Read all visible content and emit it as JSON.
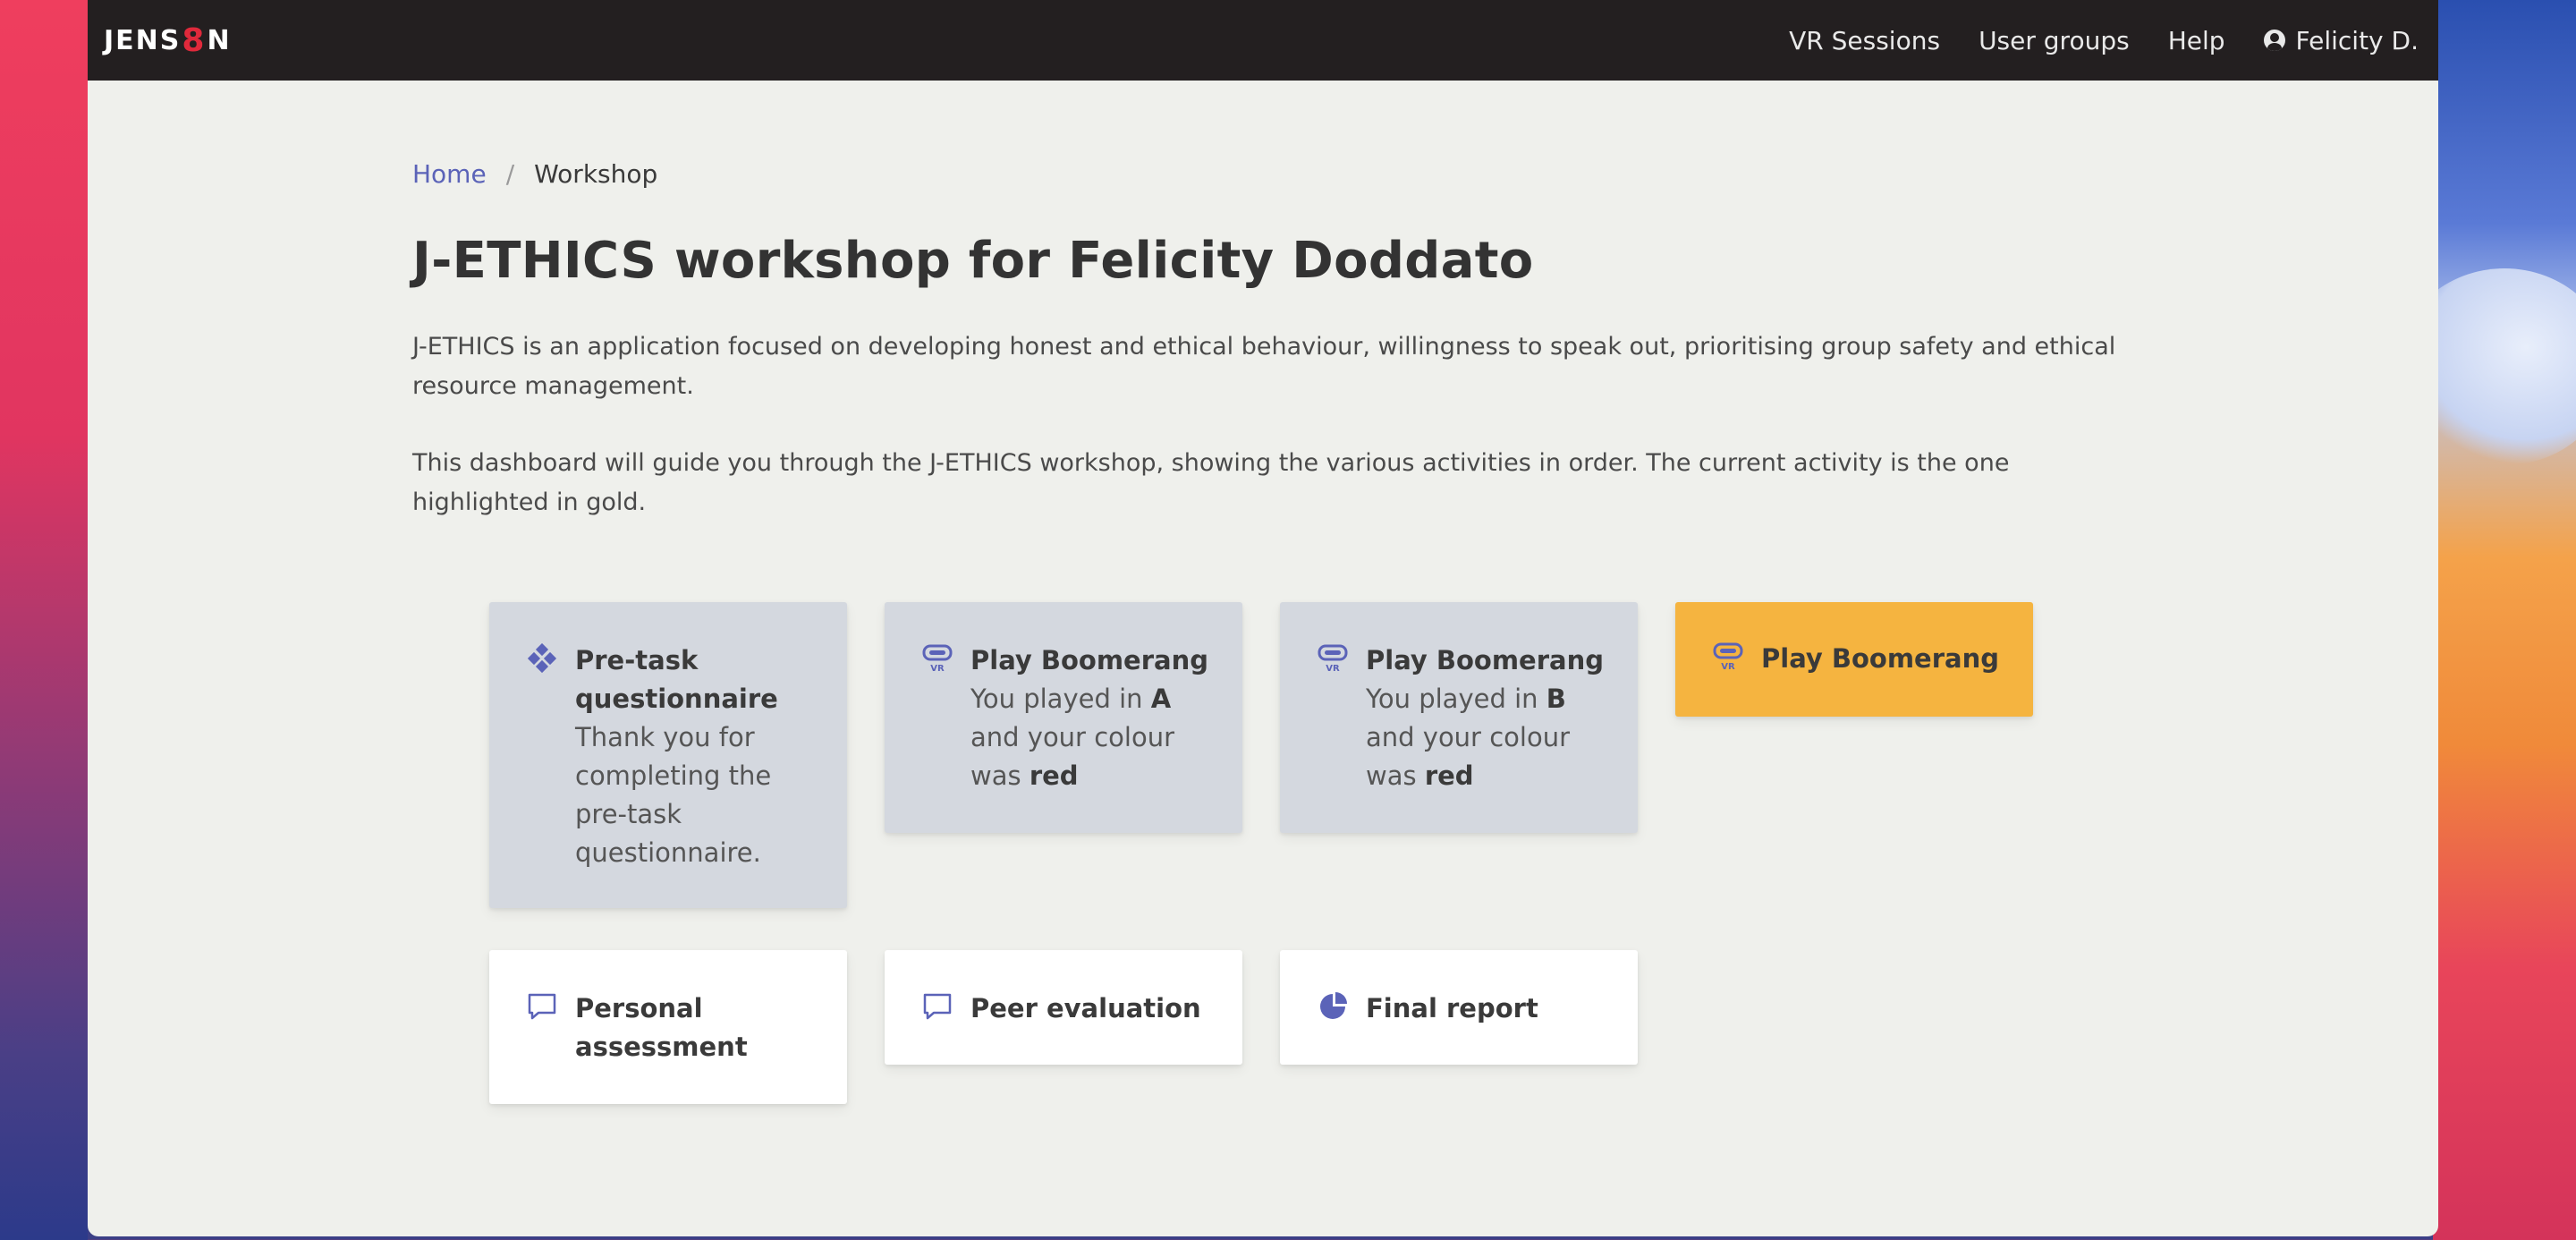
{
  "nav": {
    "brand_prefix": "JENS",
    "brand_mark": "8",
    "brand_suffix": "N",
    "links": [
      "VR Sessions",
      "User groups",
      "Help"
    ],
    "user_name": "Felicity D."
  },
  "breadcrumb": {
    "home": "Home",
    "separator": "/",
    "current": "Workshop"
  },
  "page": {
    "title": "J-ETHICS workshop for Felicity Doddato",
    "para1": "J-ETHICS is an application focused on developing honest and ethical behaviour, willingness to speak out, prioritising group safety and ethical resource management.",
    "para2": "This dashboard will guide you through the J-ETHICS workshop, showing the various activities in order. The current activity is the one highlighted in gold."
  },
  "cards": {
    "c1": {
      "title": "Pre-task questionnaire",
      "desc": "Thank you for completing the pre-task questionnaire.",
      "icon": "diamond-grid-icon"
    },
    "c2": {
      "title": "Play Boomerang",
      "desc_a": "You played in ",
      "group": "A",
      "desc_b": " and your colour was ",
      "colour": "red",
      "icon": "vr-headset-icon"
    },
    "c3": {
      "title": "Play Boomerang",
      "desc_a": "You played in ",
      "group": "B",
      "desc_b": " and your colour was ",
      "colour": "red",
      "icon": "vr-headset-icon"
    },
    "c4": {
      "title": "Play Boomerang",
      "icon": "vr-headset-icon"
    },
    "c5": {
      "title": "Personal assessment",
      "icon": "speech-bubble-icon"
    },
    "c6": {
      "title": "Peer evaluation",
      "icon": "speech-bubble-icon"
    },
    "c7": {
      "title": "Final report",
      "icon": "pie-chart-icon"
    }
  },
  "colors": {
    "navbar": "#231f20",
    "accent_link": "#5b63b8",
    "icon": "#5b63b8",
    "current_card": "#f5b440",
    "done_card": "#d4d8df",
    "background": "#eff0ec"
  }
}
